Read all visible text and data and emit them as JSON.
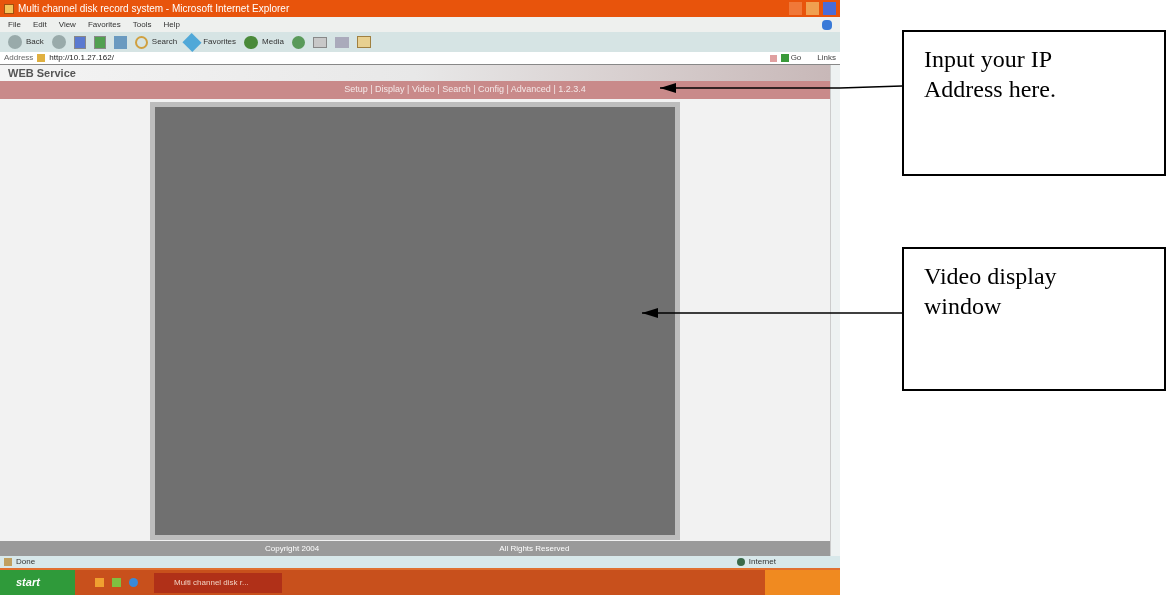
{
  "window": {
    "title": "Multi channel disk record system - Microsoft Internet Explorer"
  },
  "menu": [
    "File",
    "Edit",
    "View",
    "Favorites",
    "Tools",
    "Help"
  ],
  "toolbar": [
    {
      "kind": "back",
      "label": "Back"
    },
    {
      "kind": "forward"
    },
    {
      "kind": "stop"
    },
    {
      "kind": "refresh"
    },
    {
      "kind": "home"
    },
    {
      "kind": "search",
      "label": "Search"
    },
    {
      "kind": "favorites",
      "label": "Favorites"
    },
    {
      "kind": "media",
      "label": "Media"
    },
    {
      "kind": "history"
    },
    {
      "kind": "mail"
    },
    {
      "kind": "print"
    },
    {
      "kind": "edit"
    }
  ],
  "address_bar": {
    "label": "Address",
    "value": "http://10.1.27.162/",
    "go": "Go",
    "links": "Links"
  },
  "page": {
    "brand": "WEB Service",
    "nav": "Setup | Display | Video | Search | Config | Advanced | 1.2.3.4",
    "footer": [
      "Copyright 2004",
      "All Rights Reserved"
    ]
  },
  "status_bar": {
    "text": "Done",
    "zone": "Internet"
  },
  "taskbar": {
    "start": "start",
    "task": "Multi channel disk r..."
  },
  "callouts": [
    {
      "text": "Input your IP Address here."
    },
    {
      "text": "Video display window"
    }
  ]
}
